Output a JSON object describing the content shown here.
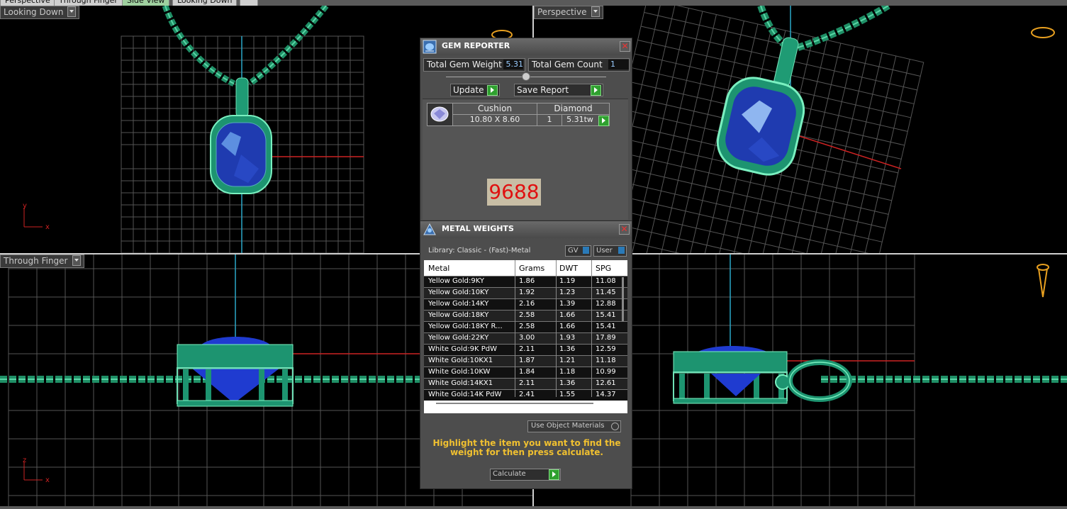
{
  "tabs": [
    {
      "label": "Perspective",
      "active": false
    },
    {
      "label": "Through Finger",
      "active": false
    },
    {
      "label": "Side View",
      "active": true
    },
    {
      "label": "Looking Down",
      "active": false
    }
  ],
  "viewports": {
    "top_left": {
      "label": "Looking Down",
      "axis_a": "y",
      "axis_b": "x"
    },
    "top_right": {
      "label": "Perspective"
    },
    "bottom_left": {
      "label": "Through Finger",
      "axis_a": "z",
      "axis_b": "x"
    }
  },
  "gem_reporter": {
    "title": "GEM REPORTER",
    "total_weight_label": "Total Gem Weight",
    "total_weight_value": "5.31",
    "total_count_label": "Total Gem Count",
    "total_count_value": "1",
    "update_label": "Update",
    "save_report_label": "Save Report",
    "gem": {
      "shape": "Cushion",
      "material": "Diamond",
      "size": "10.80 X 8.60",
      "qty": "1",
      "weight": "5.31tw"
    },
    "code": "9688"
  },
  "metal_weights": {
    "title": "METAL WEIGHTS",
    "library": "Library: Classic - (Fast)-Metal",
    "gv_label": "GV",
    "user_label": "User",
    "columns": [
      "Metal",
      "Grams",
      "DWT",
      "SPG"
    ],
    "rows": [
      [
        "Yellow Gold:9KY",
        "1.86",
        "1.19",
        "11.08"
      ],
      [
        "Yellow Gold:10KY",
        "1.92",
        "1.23",
        "11.45"
      ],
      [
        "Yellow Gold:14KY",
        "2.16",
        "1.39",
        "12.88"
      ],
      [
        "Yellow Gold:18KY",
        "2.58",
        "1.66",
        "15.41"
      ],
      [
        "Yellow Gold:18KY R...",
        "2.58",
        "1.66",
        "15.41"
      ],
      [
        "Yellow Gold:22KY",
        "3.00",
        "1.93",
        "17.89"
      ],
      [
        "White Gold:9K PdW",
        "2.11",
        "1.36",
        "12.59"
      ],
      [
        "White Gold:10KX1",
        "1.87",
        "1.21",
        "11.18"
      ],
      [
        "White Gold:10KW",
        "1.84",
        "1.18",
        "10.99"
      ],
      [
        "White Gold:14KX1",
        "2.11",
        "1.36",
        "12.61"
      ],
      [
        "White Gold:14K PdW",
        "2.41",
        "1.55",
        "14.37"
      ]
    ],
    "use_object_materials": "Use Object Materials",
    "instruction": "Highlight the item you want to find the weight for then press calculate.",
    "calculate_label": "Calculate"
  }
}
